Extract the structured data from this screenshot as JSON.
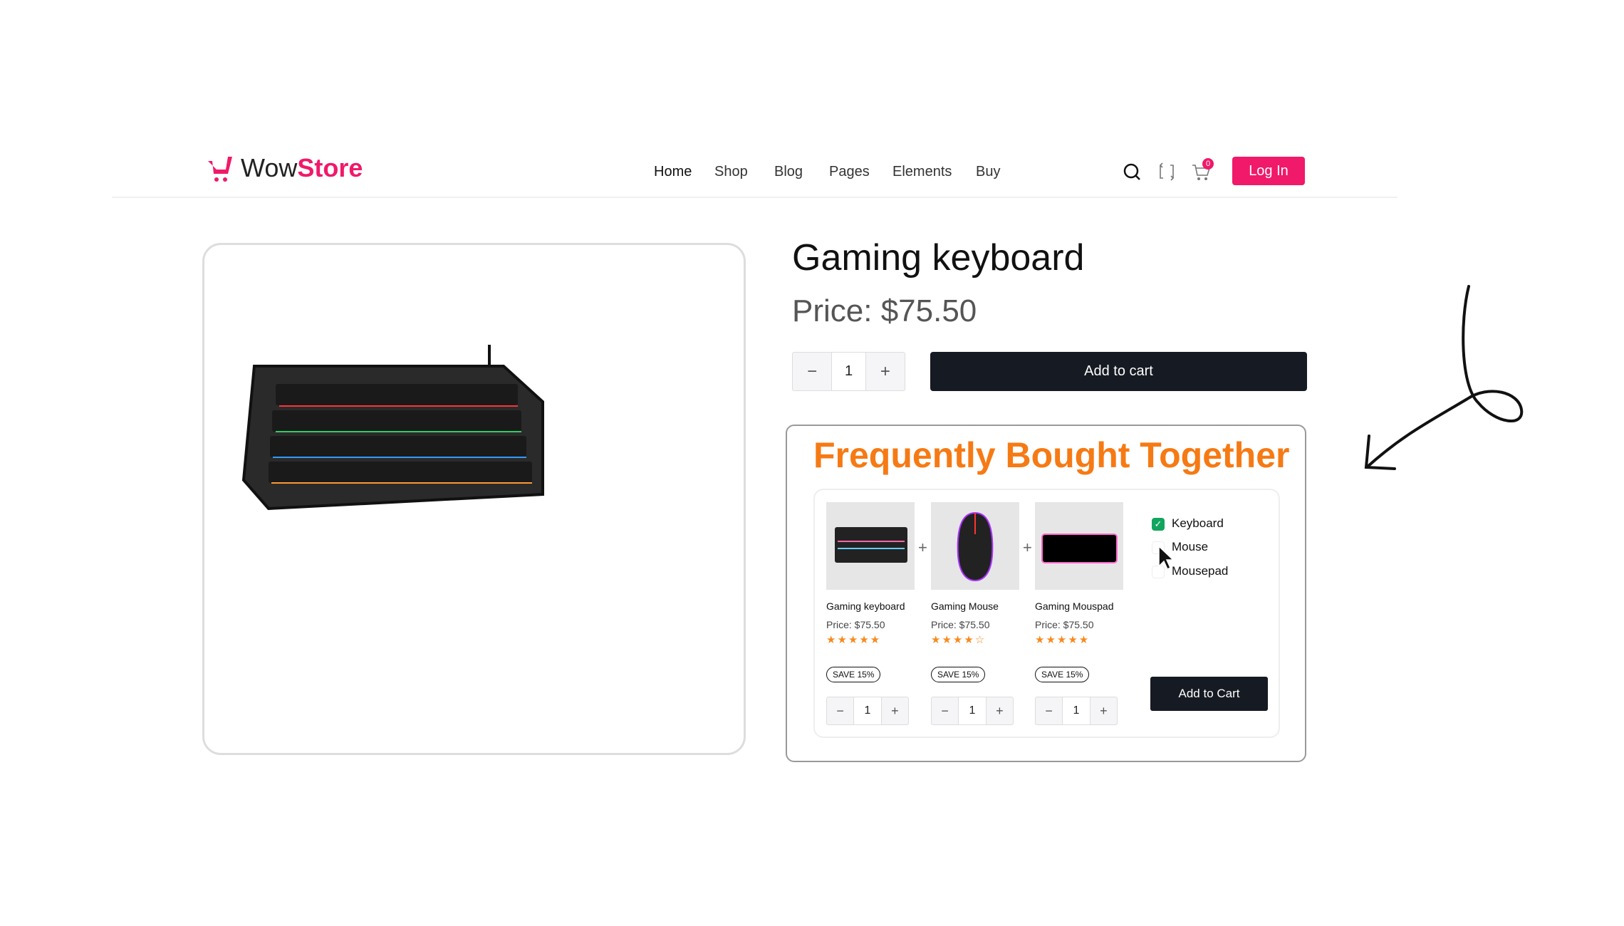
{
  "brand": {
    "part1": "Wow",
    "part2": "Store",
    "color": "#f0196a"
  },
  "nav": [
    "Home",
    "Shop",
    "Blog",
    "Pages",
    "Elements",
    "Buy"
  ],
  "header": {
    "cart_count": "0",
    "login": "Log In"
  },
  "product": {
    "title": "Gaming keyboard",
    "price": "Price: $75.50",
    "quantity": "1",
    "add_to_cart": "Add to cart"
  },
  "fbt": {
    "title": "Frequently Bought Together",
    "items": [
      {
        "name": "Gaming keyboard",
        "price": "Price: $75.50",
        "stars": "★★★★★",
        "rating": 5,
        "badge": "SAVE 15%",
        "qty": "1"
      },
      {
        "name": "Gaming Mouse",
        "price": "Price: $75.50",
        "stars": "★★★★☆",
        "rating": 4,
        "badge": "SAVE 15%",
        "qty": "1"
      },
      {
        "name": "Gaming Mouspad",
        "price": "Price: $75.50",
        "stars": "★★★★★",
        "rating": 5,
        "badge": "SAVE 15%",
        "qty": "1"
      }
    ],
    "checks": [
      {
        "label": "Keyboard",
        "checked": true
      },
      {
        "label": "Mouse",
        "checked": false
      },
      {
        "label": "Mousepad",
        "checked": false
      }
    ],
    "button": "Add to Cart"
  },
  "colors": {
    "accent": "#f0196a",
    "fbt_title": "#f67a14",
    "dark": "#161a22",
    "check": "#12a55e"
  }
}
